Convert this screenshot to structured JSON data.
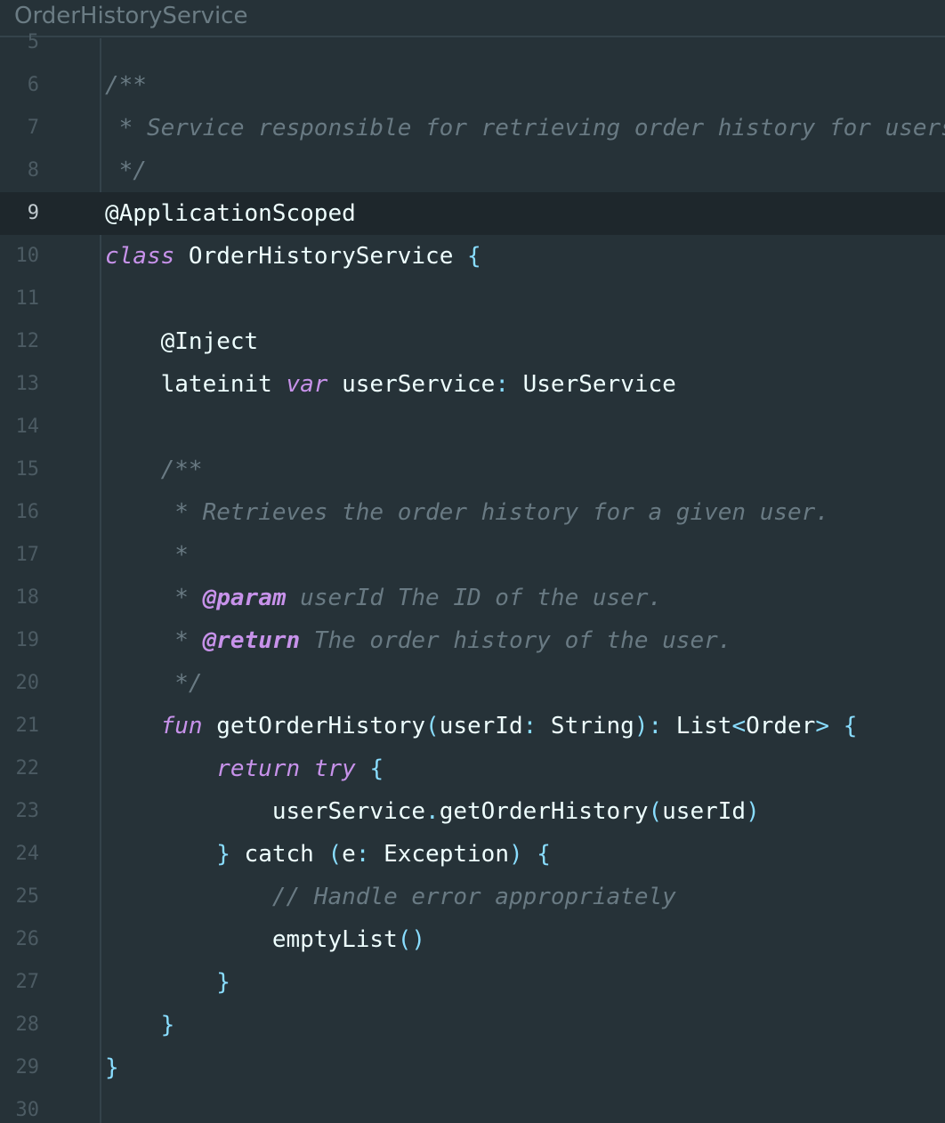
{
  "window": {
    "title": "OrderHistoryService"
  },
  "editor": {
    "current_line": 9,
    "lines": [
      {
        "n": "5",
        "segments": []
      },
      {
        "n": "6",
        "segments": [
          {
            "t": "/**",
            "c": "cm"
          }
        ]
      },
      {
        "n": "7",
        "segments": [
          {
            "t": " * Service responsible for retrieving order history for users.",
            "c": "cm"
          }
        ]
      },
      {
        "n": "8",
        "segments": [
          {
            "t": " */",
            "c": "cm"
          }
        ]
      },
      {
        "n": "9",
        "segments": [
          {
            "t": "@ApplicationScoped",
            "c": "an"
          }
        ]
      },
      {
        "n": "10",
        "segments": [
          {
            "t": "class",
            "c": "kw"
          },
          {
            "t": " OrderHistoryService ",
            "c": "ty"
          },
          {
            "t": "{",
            "c": "pn"
          }
        ]
      },
      {
        "n": "11",
        "segments": []
      },
      {
        "n": "12",
        "segments": [
          {
            "t": "    @Inject",
            "c": "an"
          }
        ]
      },
      {
        "n": "13",
        "segments": [
          {
            "t": "    lateinit ",
            "c": "ty"
          },
          {
            "t": "var",
            "c": "kw"
          },
          {
            "t": " userService",
            "c": "ty"
          },
          {
            "t": ":",
            "c": "pn"
          },
          {
            "t": " UserService",
            "c": "ty"
          }
        ]
      },
      {
        "n": "14",
        "segments": []
      },
      {
        "n": "15",
        "segments": [
          {
            "t": "    /**",
            "c": "cm"
          }
        ]
      },
      {
        "n": "16",
        "segments": [
          {
            "t": "     * Retrieves the order history for a given user.",
            "c": "cm"
          }
        ]
      },
      {
        "n": "17",
        "segments": [
          {
            "t": "     *",
            "c": "cm"
          }
        ]
      },
      {
        "n": "18",
        "segments": [
          {
            "t": "     * ",
            "c": "cm"
          },
          {
            "t": "@param",
            "c": "tag"
          },
          {
            "t": " userId The ID of the user.",
            "c": "cm"
          }
        ]
      },
      {
        "n": "19",
        "segments": [
          {
            "t": "     * ",
            "c": "cm"
          },
          {
            "t": "@return",
            "c": "tag"
          },
          {
            "t": " The order history of the user.",
            "c": "cm"
          }
        ]
      },
      {
        "n": "20",
        "segments": [
          {
            "t": "     */",
            "c": "cm"
          }
        ]
      },
      {
        "n": "21",
        "segments": [
          {
            "t": "    fun",
            "c": "kw"
          },
          {
            "t": " getOrderHistory",
            "c": "ty"
          },
          {
            "t": "(",
            "c": "pn"
          },
          {
            "t": "userId",
            "c": "ty"
          },
          {
            "t": ":",
            "c": "pn"
          },
          {
            "t": " String",
            "c": "ty"
          },
          {
            "t": "):",
            "c": "pn"
          },
          {
            "t": " List",
            "c": "ty"
          },
          {
            "t": "<",
            "c": "pn"
          },
          {
            "t": "Order",
            "c": "ty"
          },
          {
            "t": ">",
            "c": "pn"
          },
          {
            "t": " ",
            "c": "ty"
          },
          {
            "t": "{",
            "c": "pn"
          }
        ]
      },
      {
        "n": "22",
        "segments": [
          {
            "t": "        return",
            "c": "kw"
          },
          {
            "t": " ",
            "c": "ty"
          },
          {
            "t": "try",
            "c": "kw"
          },
          {
            "t": " ",
            "c": "ty"
          },
          {
            "t": "{",
            "c": "pn"
          }
        ]
      },
      {
        "n": "23",
        "segments": [
          {
            "t": "            userService",
            "c": "ty"
          },
          {
            "t": ".",
            "c": "pn"
          },
          {
            "t": "getOrderHistory",
            "c": "ty"
          },
          {
            "t": "(",
            "c": "pn"
          },
          {
            "t": "userId",
            "c": "ty"
          },
          {
            "t": ")",
            "c": "pn"
          }
        ]
      },
      {
        "n": "24",
        "segments": [
          {
            "t": "        ",
            "c": "ty"
          },
          {
            "t": "}",
            "c": "pn"
          },
          {
            "t": " catch ",
            "c": "ty"
          },
          {
            "t": "(",
            "c": "pn"
          },
          {
            "t": "e",
            "c": "ty"
          },
          {
            "t": ":",
            "c": "pn"
          },
          {
            "t": " Exception",
            "c": "ty"
          },
          {
            "t": ")",
            "c": "pn"
          },
          {
            "t": " ",
            "c": "ty"
          },
          {
            "t": "{",
            "c": "pn"
          }
        ]
      },
      {
        "n": "25",
        "segments": [
          {
            "t": "            // Handle error appropriately",
            "c": "cm"
          }
        ]
      },
      {
        "n": "26",
        "segments": [
          {
            "t": "            emptyList",
            "c": "ty"
          },
          {
            "t": "()",
            "c": "pn"
          }
        ]
      },
      {
        "n": "27",
        "segments": [
          {
            "t": "        ",
            "c": "ty"
          },
          {
            "t": "}",
            "c": "pn"
          }
        ]
      },
      {
        "n": "28",
        "segments": [
          {
            "t": "    ",
            "c": "ty"
          },
          {
            "t": "}",
            "c": "pn"
          }
        ]
      },
      {
        "n": "29",
        "segments": [
          {
            "t": "}",
            "c": "pn"
          }
        ]
      },
      {
        "n": "30",
        "segments": []
      }
    ]
  },
  "theme": {
    "background": "#263238",
    "current_line": "#1e272c",
    "keyword": "#c792ea",
    "comment": "#697a83",
    "punctuation": "#89ddff",
    "text": "#eeffff"
  }
}
